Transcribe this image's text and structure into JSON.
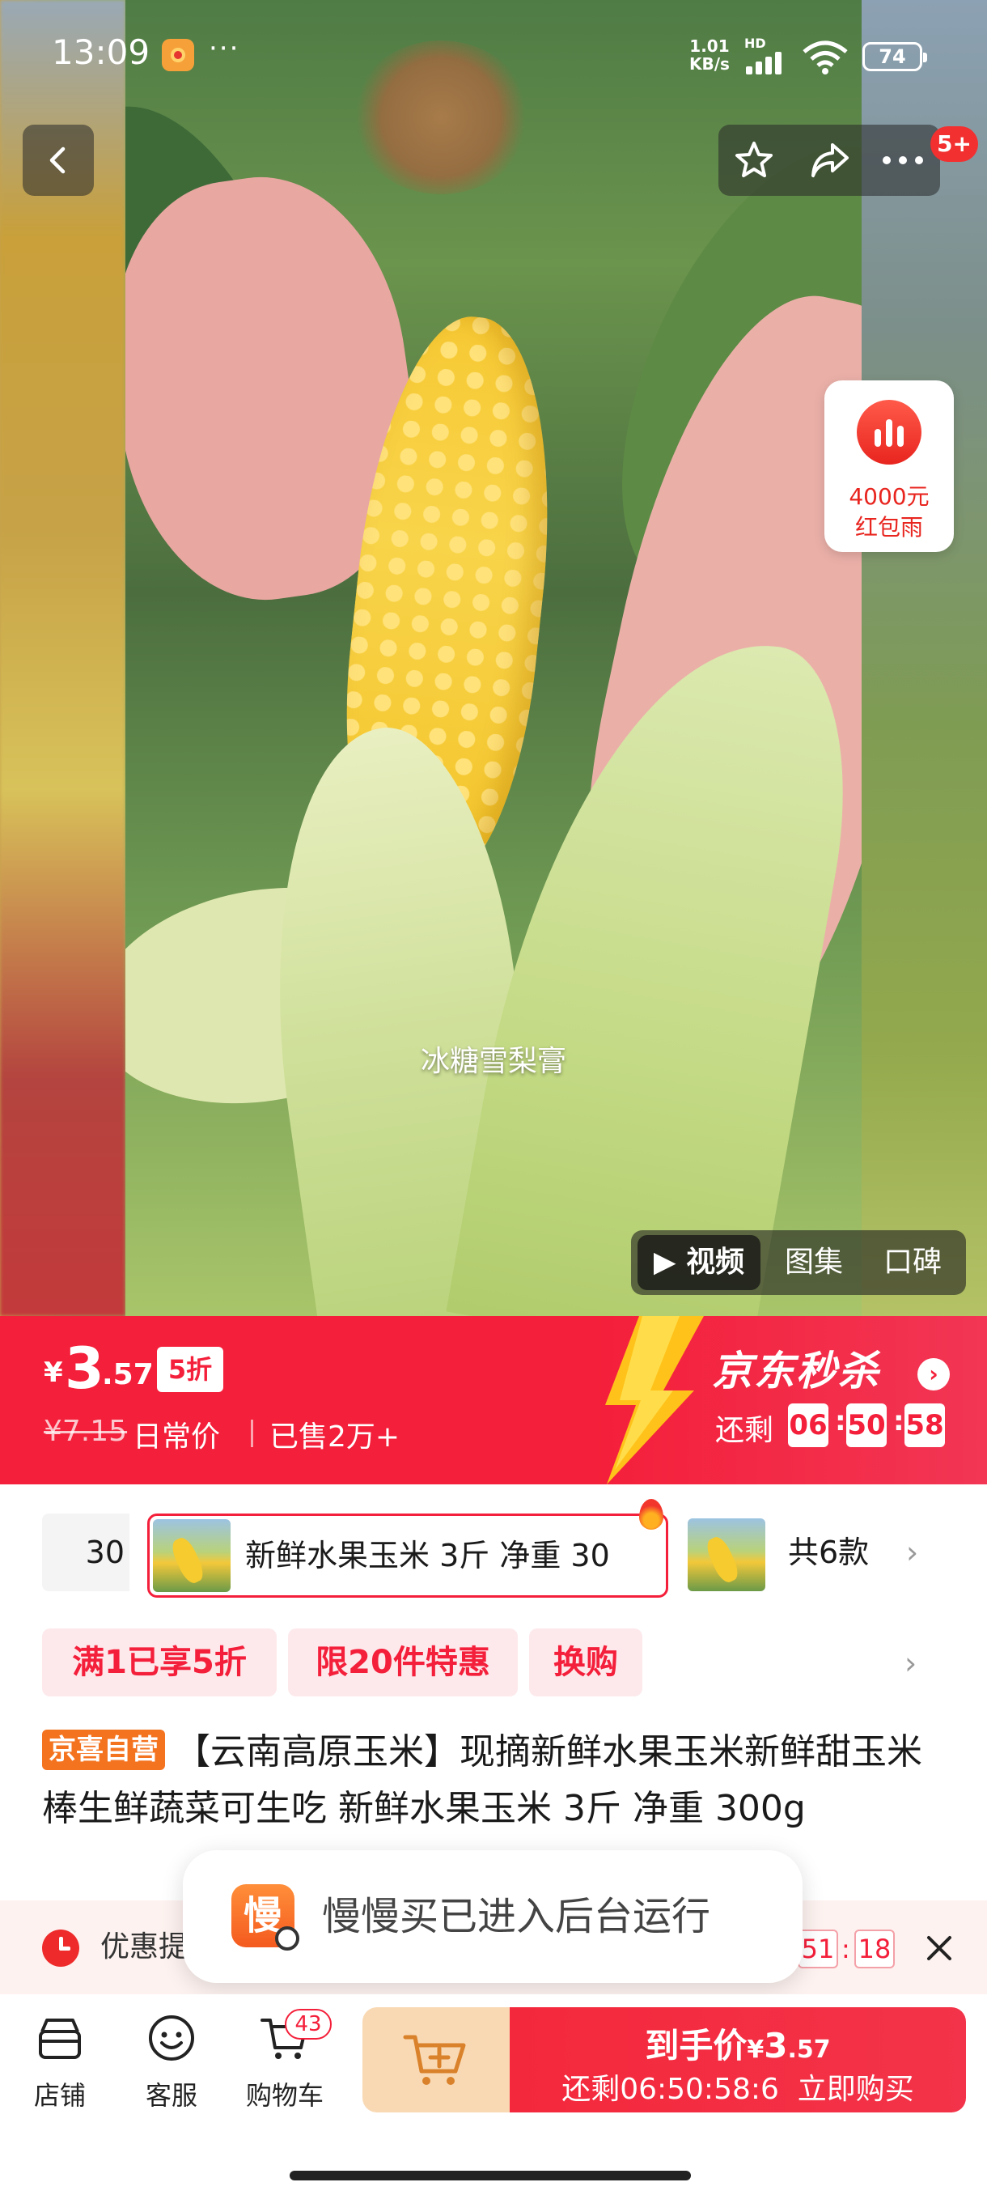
{
  "status_bar": {
    "time": "13:09",
    "more": "···",
    "net_speed_value": "1.01",
    "net_speed_unit": "KB/s",
    "hd_label": "HD",
    "battery": "74"
  },
  "top_nav": {
    "message_badge": "5+"
  },
  "media": {
    "caption": "冰糖雪梨膏",
    "tabs": [
      {
        "label": "▶ 视频",
        "active": true
      },
      {
        "label": "图集",
        "active": false
      },
      {
        "label": "口碑",
        "active": false
      }
    ]
  },
  "red_packet": {
    "amount": "4000元",
    "label": "红包雨"
  },
  "price": {
    "currency": "¥",
    "integer": "3",
    "decimal": ".57",
    "discount": "5折",
    "original": "¥7.15",
    "daily_label": "日常价",
    "sold": "已售2万+"
  },
  "seckill": {
    "title": "京东秒杀",
    "remain_label": "还剩",
    "countdown": [
      "06",
      "50",
      "58"
    ]
  },
  "sku": {
    "partial_left": "30",
    "selected": "新鲜水果玉米 3斤 净重 30",
    "count": "共6款"
  },
  "promos": [
    "满1已享5折",
    "限20件特惠",
    "换购"
  ],
  "title": {
    "badge": "京喜自营",
    "text": "【云南高原玉米】现摘新鲜水果玉米新鲜甜玉米棒生鲜蔬菜可生吃 新鲜水果玉米 3斤 净重 300g"
  },
  "notice": {
    "text": "优惠提",
    "countdown_visible": [
      "51",
      "18"
    ]
  },
  "toast": {
    "icon_char": "慢",
    "text": "慢慢买已进入后台运行"
  },
  "bottom_bar": {
    "store": "店铺",
    "service": "客服",
    "cart": "购物车",
    "cart_badge": "43",
    "buy_label": "到手价",
    "buy_currency": "¥",
    "buy_price": "3",
    "buy_price_decimal": ".57",
    "buy_countdown": "还剩06:50:58:6",
    "buy_action": "立即购买"
  },
  "colors": {
    "brand_red": "#f41f3a",
    "promo_bg": "#fde9ec",
    "self_badge": "#f4731f",
    "add_cart_bg": "#f9d9b4"
  },
  "icons": {
    "back": "chevron-left-icon",
    "favorite": "star-icon",
    "share": "share-icon",
    "more": "more-dots-icon",
    "store": "store-icon",
    "service": "smiley-icon",
    "cart": "cart-icon",
    "add_cart": "cart-plus-icon",
    "close": "close-icon",
    "clock": "clock-icon"
  }
}
